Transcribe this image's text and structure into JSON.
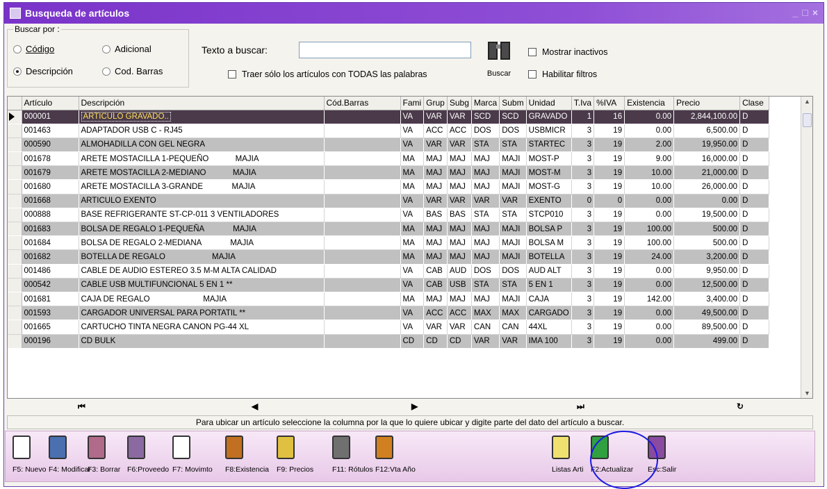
{
  "window": {
    "title": "Busqueda de artículos",
    "controls": "_ □ ×"
  },
  "search": {
    "group_label": "Buscar por :",
    "options": [
      {
        "label": "Código",
        "checked": false
      },
      {
        "label": "Adicional",
        "checked": false
      },
      {
        "label": "Descripción",
        "checked": true
      },
      {
        "label": "Cod. Barras",
        "checked": false
      }
    ],
    "text_label": "Texto a buscar:",
    "text_value": "",
    "all_words_label": "Traer sólo los artículos con TODAS las palabras",
    "buscar_label": "Buscar",
    "show_inactive_label": "Mostrar inactivos",
    "enable_filters_label": "Habilitar filtros"
  },
  "grid": {
    "columns": [
      "Artículo",
      "Descripción",
      "Cód.Barras",
      "Fami",
      "Grup",
      "Subg",
      "Marca",
      "Subm",
      "Unidad",
      "T.Iva",
      "%IVA",
      "Existencia",
      "Precio",
      "Clase"
    ],
    "rows": [
      [
        "000001",
        "ARTICULO GRAVADO..",
        "",
        "VA",
        "VAR",
        "VAR",
        "SCD",
        "SCD",
        "GRAVADO",
        "1",
        "16",
        "0.00",
        "2,844,100.00",
        "D"
      ],
      [
        "001463",
        "ADAPTADOR USB C - RJ45",
        "",
        "VA",
        "ACC",
        "ACC",
        "DOS",
        "DOS",
        "USBMICR",
        "3",
        "19",
        "0.00",
        "6,500.00",
        "D"
      ],
      [
        "000590",
        "ALMOHADILLA CON GEL NEGRA",
        "",
        "VA",
        "VAR",
        "VAR",
        "STA",
        "STA",
        "STARTEC",
        "3",
        "19",
        "2.00",
        "19,950.00",
        "D"
      ],
      [
        "001678",
        "ARETE MOSTACILLA 1-PEQUEÑO            MAJIA",
        "",
        "MA",
        "MAJ",
        "MAJ",
        "MAJ",
        "MAJI",
        "MOST-P",
        "3",
        "19",
        "9.00",
        "16,000.00",
        "D"
      ],
      [
        "001679",
        "ARETE MOSTACILLA 2-MEDIANO            MAJIA",
        "",
        "MA",
        "MAJ",
        "MAJ",
        "MAJ",
        "MAJI",
        "MOST-M",
        "3",
        "19",
        "10.00",
        "21,000.00",
        "D"
      ],
      [
        "001680",
        "ARETE MOSTACILLA 3-GRANDE             MAJIA",
        "",
        "MA",
        "MAJ",
        "MAJ",
        "MAJ",
        "MAJI",
        "MOST-G",
        "3",
        "19",
        "10.00",
        "26,000.00",
        "D"
      ],
      [
        "001668",
        "ARTICULO EXENTO",
        "",
        "VA",
        "VAR",
        "VAR",
        "VAR",
        "VAR",
        "EXENTO",
        "0",
        "0",
        "0.00",
        "0.00",
        "D"
      ],
      [
        "000888",
        "BASE REFRIGERANTE ST-CP-011 3 VENTILADORES",
        "",
        "VA",
        "BAS",
        "BAS",
        "STA",
        "STA",
        "STCP010",
        "3",
        "19",
        "0.00",
        "19,500.00",
        "D"
      ],
      [
        "001683",
        "BOLSA DE REGALO 1-PEQUEÑA             MAJIA",
        "",
        "MA",
        "MAJ",
        "MAJ",
        "MAJ",
        "MAJI",
        "BOLSA P",
        "3",
        "19",
        "100.00",
        "500.00",
        "D"
      ],
      [
        "001684",
        "BOLSA DE REGALO 2-MEDIANA             MAJIA",
        "",
        "MA",
        "MAJ",
        "MAJ",
        "MAJ",
        "MAJI",
        "BOLSA M",
        "3",
        "19",
        "100.00",
        "500.00",
        "D"
      ],
      [
        "001682",
        "BOTELLA DE REGALO                     MAJIA",
        "",
        "MA",
        "MAJ",
        "MAJ",
        "MAJ",
        "MAJI",
        "BOTELLA",
        "3",
        "19",
        "24.00",
        "3,200.00",
        "D"
      ],
      [
        "001486",
        "CABLE DE AUDIO ESTEREO 3.5 M-M ALTA CALIDAD",
        "",
        "VA",
        "CAB",
        "AUD",
        "DOS",
        "DOS",
        "AUD ALT",
        "3",
        "19",
        "0.00",
        "9,950.00",
        "D"
      ],
      [
        "000542",
        "CABLE USB MULTIFUNCIONAL 5 EN 1 **",
        "",
        "VA",
        "CAB",
        "USB",
        "STA",
        "STA",
        "5 EN 1",
        "3",
        "19",
        "0.00",
        "12,500.00",
        "D"
      ],
      [
        "001681",
        "CAJA DE REGALO                        MAJIA",
        "",
        "MA",
        "MAJ",
        "MAJ",
        "MAJ",
        "MAJI",
        "CAJA",
        "3",
        "19",
        "142.00",
        "3,400.00",
        "D"
      ],
      [
        "001593",
        "CARGADOR UNIVERSAL PARA PORTATIL **",
        "",
        "VA",
        "ACC",
        "ACC",
        "MAX",
        "MAX",
        "CARGADO",
        "3",
        "19",
        "0.00",
        "49,500.00",
        "D"
      ],
      [
        "001665",
        "CARTUCHO TINTA NEGRA CANON PG-44 XL",
        "",
        "VA",
        "VAR",
        "VAR",
        "CAN",
        "CAN",
        "44XL",
        "3",
        "19",
        "0.00",
        "89,500.00",
        "D"
      ],
      [
        "000196",
        "CD BULK",
        "",
        "CD",
        "CD",
        "CD",
        "VAR",
        "VAR",
        "IMA 100",
        "3",
        "19",
        "0.00",
        "499.00",
        "D"
      ]
    ]
  },
  "nav": {
    "first": "⏮",
    "prev": "◀",
    "next": "▶",
    "last": "⏭",
    "refresh": "↻"
  },
  "hint": "Para ubicar un artículo seleccione la columna por la que lo quiere ubicar y digite parte del dato del artículo a buscar.",
  "toolbar": [
    {
      "label": "F5: Nuevo",
      "icon": "new-doc-icon"
    },
    {
      "label": "F4: Modificar",
      "icon": "printer-icon"
    },
    {
      "label": "F3: Borrar",
      "icon": "eraser-icon"
    },
    {
      "label": "F6:Proveedo",
      "icon": "supplier-icon"
    },
    {
      "label": "F7: Movimto",
      "icon": "ledger-icon"
    },
    {
      "label": "F8:Existencia",
      "icon": "stock-icon"
    },
    {
      "label": "F9: Precios",
      "icon": "price-tag-icon"
    },
    {
      "label": "F11: Rótulos",
      "icon": "label-printer-icon"
    },
    {
      "label": "F12:Vta Año",
      "icon": "chart-magnifier-icon"
    },
    {
      "label": "Listas Arti",
      "icon": "list-icon"
    },
    {
      "label": "F2:Actualizar",
      "icon": "refresh-icon"
    },
    {
      "label": "Esc:Salir",
      "icon": "exit-icon"
    }
  ],
  "colors": {
    "title_bar": "#7a33c9",
    "row_gray": "#c0c0c0",
    "selected_row": "#4a3a4a",
    "highlight_circle": "#1a1ae0"
  }
}
